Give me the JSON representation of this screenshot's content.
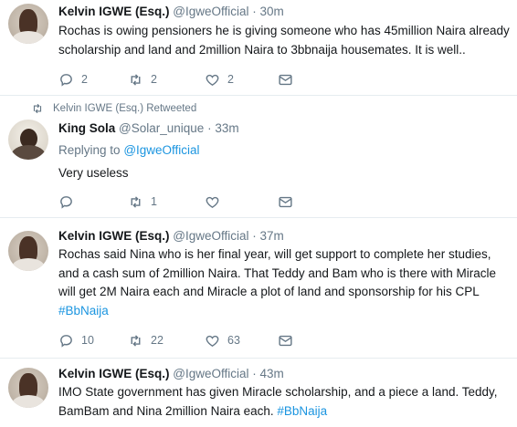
{
  "tweets": [
    {
      "name": "Kelvin IGWE (Esq.)",
      "handle": "@IgweOfficial",
      "time": "30m",
      "lines": [
        "Rochas is owing pensioners he is giving someone who has 45million Naira already",
        "scholarship and land and 2million Naira to 3bbnaija housemates. It is well.."
      ],
      "replies": "2",
      "retweets": "2",
      "likes": "2"
    },
    {
      "retweeted_by": "Kelvin IGWE (Esq.) Retweeted",
      "name": "King Sola",
      "handle": "@Solar_unique",
      "time": "33m",
      "replying_prefix": "Replying to",
      "replying_handle": "@IgweOfficial",
      "lines": [
        "Very useless"
      ],
      "replies": "",
      "retweets": "1",
      "likes": ""
    },
    {
      "name": "Kelvin IGWE (Esq.)",
      "handle": "@IgweOfficial",
      "time": "37m",
      "lines": [
        "Rochas said Nina who is her final year, will get support to complete her studies,",
        "and a cash sum of 2million Naira. That Teddy and Bam who is there with Miracle",
        "will get 2M Naira each and Miracle a plot of land and sponsorship for his CPL"
      ],
      "hashtag": "#BbNaija",
      "replies": "10",
      "retweets": "22",
      "likes": "63"
    },
    {
      "name": "Kelvin IGWE (Esq.)",
      "handle": "@IgweOfficial",
      "time": "43m",
      "lines": [
        "IMO State government has given Miracle scholarship, and a piece a land. Teddy,",
        "BamBam and Nina 2million Naira each."
      ],
      "hashtag": "#BbNaija"
    }
  ],
  "separator": " · ",
  "icons": {
    "reply": "reply-icon",
    "retweet": "retweet-icon",
    "like": "heart-icon",
    "message": "message-icon"
  },
  "colors": {
    "link": "#1b95e0",
    "muted": "#657786",
    "text": "#14171a",
    "divider": "#e6ecf0"
  }
}
